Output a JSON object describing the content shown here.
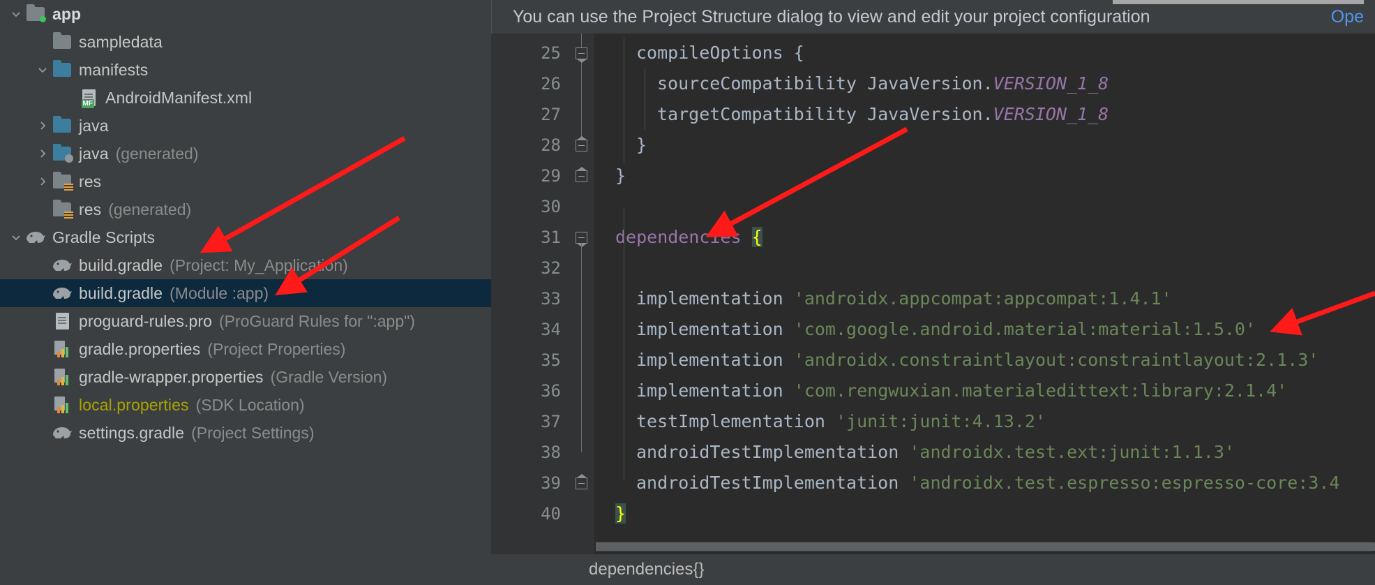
{
  "notification": {
    "message": "You can use the Project Structure dialog to view and edit your project configuration",
    "action_label": "Ope"
  },
  "project_tree": {
    "items": [
      {
        "label": "app",
        "hint": "",
        "icon": "folder-module-icon",
        "indent": 0,
        "toggle": "expanded",
        "style": "bold",
        "selected": false
      },
      {
        "label": "sampledata",
        "hint": "",
        "icon": "folder-icon",
        "indent": 1,
        "toggle": "none",
        "style": "normal",
        "selected": false
      },
      {
        "label": "manifests",
        "hint": "",
        "icon": "folder-blue-icon",
        "indent": 1,
        "toggle": "expanded",
        "style": "normal",
        "selected": false
      },
      {
        "label": "AndroidManifest.xml",
        "hint": "",
        "icon": "manifest-file-icon",
        "indent": 2,
        "toggle": "none",
        "style": "normal",
        "selected": false
      },
      {
        "label": "java",
        "hint": "",
        "icon": "folder-blue-icon",
        "indent": 1,
        "toggle": "collapsed",
        "style": "normal",
        "selected": false
      },
      {
        "label": "java",
        "hint": "(generated)",
        "icon": "folder-generated-icon",
        "indent": 1,
        "toggle": "collapsed",
        "style": "normal",
        "selected": false
      },
      {
        "label": "res",
        "hint": "",
        "icon": "folder-res-icon",
        "indent": 1,
        "toggle": "collapsed",
        "style": "normal",
        "selected": false
      },
      {
        "label": "res",
        "hint": "(generated)",
        "icon": "folder-res-icon",
        "indent": 1,
        "toggle": "none",
        "style": "normal",
        "selected": false
      },
      {
        "label": "Gradle Scripts",
        "hint": "",
        "icon": "gradle-elephant-icon",
        "indent": 0,
        "toggle": "expanded",
        "style": "normal",
        "selected": false
      },
      {
        "label": "build.gradle",
        "hint": "(Project: My_Application)",
        "icon": "gradle-elephant-icon",
        "indent": 1,
        "toggle": "none",
        "style": "normal",
        "selected": false
      },
      {
        "label": "build.gradle",
        "hint": "(Module :app)",
        "icon": "gradle-elephant-icon",
        "indent": 1,
        "toggle": "none",
        "style": "normal",
        "selected": true
      },
      {
        "label": "proguard-rules.pro",
        "hint": "(ProGuard Rules for \":app\")",
        "icon": "text-file-icon",
        "indent": 1,
        "toggle": "none",
        "style": "normal",
        "selected": false
      },
      {
        "label": "gradle.properties",
        "hint": "(Project Properties)",
        "icon": "properties-file-icon",
        "indent": 1,
        "toggle": "none",
        "style": "normal",
        "selected": false
      },
      {
        "label": "gradle-wrapper.properties",
        "hint": "(Gradle Version)",
        "icon": "properties-file-icon",
        "indent": 1,
        "toggle": "none",
        "style": "normal",
        "selected": false
      },
      {
        "label": "local.properties",
        "hint": "(SDK Location)",
        "icon": "properties-file-icon",
        "indent": 1,
        "toggle": "none",
        "style": "olive",
        "selected": false
      },
      {
        "label": "settings.gradle",
        "hint": "(Project Settings)",
        "icon": "gradle-elephant-icon",
        "indent": 1,
        "toggle": "none",
        "style": "normal",
        "selected": false
      }
    ]
  },
  "editor": {
    "line_numbers": [
      "25",
      "26",
      "27",
      "28",
      "29",
      "30",
      "31",
      "32",
      "33",
      "34",
      "35",
      "36",
      "37",
      "38",
      "39",
      "40"
    ],
    "lines": [
      {
        "n": "25",
        "indent": 2,
        "segments": [
          {
            "t": "compileOptions {",
            "c": "plain"
          }
        ]
      },
      {
        "n": "26",
        "indent": 3,
        "segments": [
          {
            "t": "sourceCompatibility JavaVersion.",
            "c": "plain"
          },
          {
            "t": "VERSION_1_8",
            "c": "const"
          }
        ]
      },
      {
        "n": "27",
        "indent": 3,
        "segments": [
          {
            "t": "targetCompatibility JavaVersion.",
            "c": "plain"
          },
          {
            "t": "VERSION_1_8",
            "c": "const"
          }
        ]
      },
      {
        "n": "28",
        "indent": 2,
        "segments": [
          {
            "t": "}",
            "c": "plain"
          }
        ]
      },
      {
        "n": "29",
        "indent": 1,
        "segments": [
          {
            "t": "}",
            "c": "plain"
          }
        ]
      },
      {
        "n": "30",
        "indent": 0,
        "segments": []
      },
      {
        "n": "31",
        "indent": 1,
        "segments": [
          {
            "t": "dependencies ",
            "c": "fn"
          },
          {
            "t": "{",
            "c": "brace"
          }
        ]
      },
      {
        "n": "32",
        "indent": 0,
        "segments": []
      },
      {
        "n": "33",
        "indent": 2,
        "segments": [
          {
            "t": "implementation ",
            "c": "plain"
          },
          {
            "t": "'androidx.appcompat:appcompat:1.4.1'",
            "c": "str"
          }
        ]
      },
      {
        "n": "34",
        "indent": 2,
        "segments": [
          {
            "t": "implementation ",
            "c": "plain"
          },
          {
            "t": "'com.google.android.material:material:1.5.0'",
            "c": "str"
          }
        ]
      },
      {
        "n": "35",
        "indent": 2,
        "segments": [
          {
            "t": "implementation ",
            "c": "plain"
          },
          {
            "t": "'androidx.constraintlayout:constraintlayout:2.1.3'",
            "c": "str"
          }
        ]
      },
      {
        "n": "36",
        "indent": 2,
        "segments": [
          {
            "t": "implementation ",
            "c": "plain"
          },
          {
            "t": "'com.rengwuxian.materialedittext:library:2.1.4'",
            "c": "str"
          }
        ]
      },
      {
        "n": "37",
        "indent": 2,
        "segments": [
          {
            "t": "testImplementation ",
            "c": "plain"
          },
          {
            "t": "'junit:junit:4.13.2'",
            "c": "str"
          }
        ]
      },
      {
        "n": "38",
        "indent": 2,
        "segments": [
          {
            "t": "androidTestImplementation ",
            "c": "plain"
          },
          {
            "t": "'androidx.test.ext:junit:1.1.3'",
            "c": "str"
          }
        ]
      },
      {
        "n": "39",
        "indent": 2,
        "segments": [
          {
            "t": "androidTestImplementation ",
            "c": "plain"
          },
          {
            "t": "'androidx.test.espresso:espresso-core:3.4",
            "c": "str"
          }
        ]
      },
      {
        "n": "40",
        "indent": 1,
        "segments": [
          {
            "t": "}",
            "c": "brace"
          }
        ]
      }
    ]
  },
  "breadcrumb": {
    "text": "dependencies{}"
  },
  "colors": {
    "selection": "#0d293e",
    "string": "#6a8759",
    "function": "#9876aa",
    "constant": "#9876aa",
    "brace_highlight": "#ffff00",
    "link": "#5394ec",
    "annotation_arrow": "#ff1a1a",
    "olive_file": "#a9a300"
  }
}
